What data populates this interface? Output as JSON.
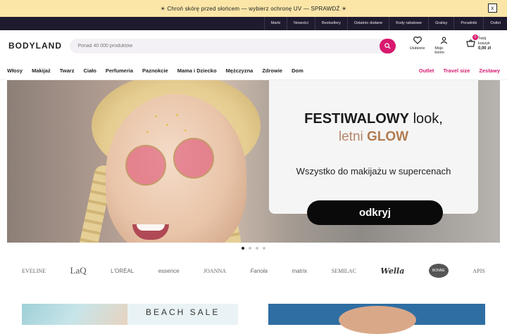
{
  "promo": {
    "text": "☀ Chroń skórę przed słońcem — wybierz ochronę UV — SPRAWDŹ ☀",
    "close_label": "x"
  },
  "toplinks": [
    "Marki",
    "Nowości",
    "Bestsellery",
    "Ostatnio dodane",
    "Kody rabatowe",
    "Gratisy",
    "Poradniki",
    "Outlet"
  ],
  "header": {
    "logo": "BODYLAND",
    "search_placeholder": "Ponad 40 000 produktów",
    "favorites_label": "Ulubione",
    "account_label": "Moje konto",
    "cart_label": "Twój koszyk",
    "cart_amount": "0,00 zł",
    "cart_count": "0"
  },
  "nav": {
    "items": [
      "Włosy",
      "Makijaż",
      "Twarz",
      "Ciało",
      "Perfumeria",
      "Paznokcie",
      "Mama i Dziecko",
      "Mężczyzna",
      "Zdrowie",
      "Dom"
    ],
    "highlight": [
      "Outlet",
      "Travel size",
      "Zestawy"
    ]
  },
  "hero": {
    "title_bold": "FESTIWALOWY",
    "title_light": " look,",
    "line2_light": "letni ",
    "line2_bold": "GLOW",
    "subtitle": "Wszystko do makijażu w supercenach",
    "cta": "odkryj",
    "slides": 4,
    "active_slide": 1
  },
  "brands": [
    "EVELINE",
    "LaQ",
    "L'ORÉAL",
    "essence",
    "JOANNA",
    "Fanola",
    "matrix",
    "SEMILAC",
    "Wella",
    "BONNE",
    "APIS"
  ],
  "tiles": {
    "tile1_text": "BEACH SALE"
  },
  "colors": {
    "accent": "#d8196f",
    "promo_bg": "#fbe6a8",
    "toplinks_bg": "#1f1b2e"
  }
}
